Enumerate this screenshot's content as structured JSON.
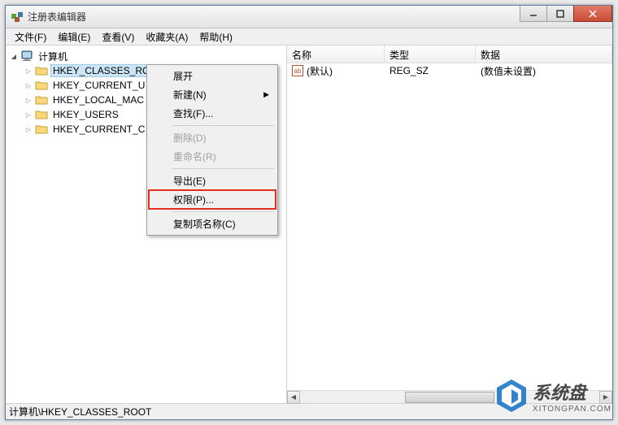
{
  "window": {
    "title": "注册表编辑器"
  },
  "menubar": {
    "items": [
      "文件(F)",
      "编辑(E)",
      "查看(V)",
      "收藏夹(A)",
      "帮助(H)"
    ]
  },
  "tree": {
    "root": "计算机",
    "keys": [
      "HKEY_CLASSES_ROOT",
      "HKEY_CURRENT_U",
      "HKEY_LOCAL_MAC",
      "HKEY_USERS",
      "HKEY_CURRENT_C"
    ]
  },
  "list": {
    "headers": {
      "name": "名称",
      "type": "类型",
      "data": "数据"
    },
    "rows": [
      {
        "icon": "ab",
        "name": "(默认)",
        "type": "REG_SZ",
        "data": "(数值未设置)"
      }
    ]
  },
  "context_menu": {
    "expand": "展开",
    "new": "新建(N)",
    "find": "查找(F)...",
    "delete": "删除(D)",
    "rename": "重命名(R)",
    "export": "导出(E)",
    "permissions": "权限(P)...",
    "copy_key_name": "复制项名称(C)"
  },
  "statusbar": {
    "path": "计算机\\HKEY_CLASSES_ROOT"
  },
  "watermark": {
    "cn": "系统盘",
    "en": "XITONGPAN.COM"
  }
}
